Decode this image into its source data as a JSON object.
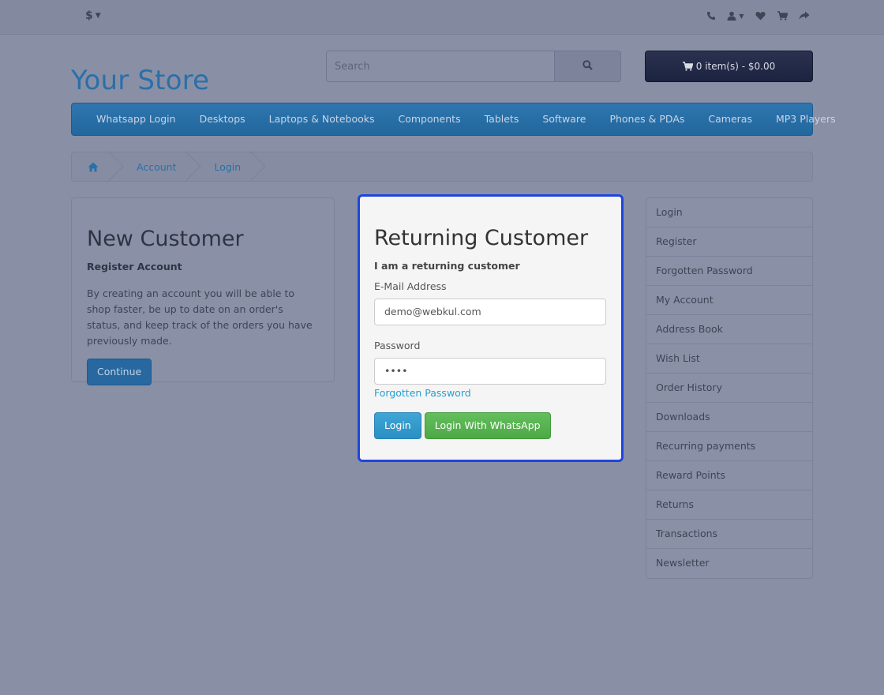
{
  "topbar": {
    "currency": "$",
    "icons": [
      "phone-icon",
      "user-icon",
      "heart-icon",
      "cart-icon",
      "share-icon"
    ]
  },
  "header": {
    "logo": "Your Store",
    "search_placeholder": "Search",
    "cart_label": "0 item(s) - $0.00"
  },
  "menu": {
    "items": [
      "Whatsapp Login",
      "Desktops",
      "Laptops & Notebooks",
      "Components",
      "Tablets",
      "Software",
      "Phones & PDAs",
      "Cameras",
      "MP3 Players"
    ]
  },
  "breadcrumb": [
    "Account",
    "Login"
  ],
  "new_customer": {
    "title": "New Customer",
    "subtitle": "Register Account",
    "text": "By creating an account you will be able to shop faster, be up to date on an order's status, and keep track of the orders you have previously made.",
    "button": "Continue"
  },
  "returning_customer": {
    "title": "Returning Customer",
    "subtitle": "I am a returning customer",
    "email_label": "E-Mail Address",
    "email_value": "demo@webkul.com",
    "password_label": "Password",
    "password_value": "••••",
    "forgot_link": "Forgotten Password",
    "login_button": "Login",
    "whatsapp_button": "Login With WhatsApp"
  },
  "sidebar": {
    "items": [
      "Login",
      "Register",
      "Forgotten Password",
      "My Account",
      "Address Book",
      "Wish List",
      "Order History",
      "Downloads",
      "Recurring payments",
      "Reward Points",
      "Returns",
      "Transactions",
      "Newsletter"
    ]
  },
  "colors": {
    "overlay": "#8990a6",
    "brand_blue": "#2b6fa8",
    "highlight_border": "#1f44e0",
    "whatsapp_green": "#5cb85c"
  }
}
